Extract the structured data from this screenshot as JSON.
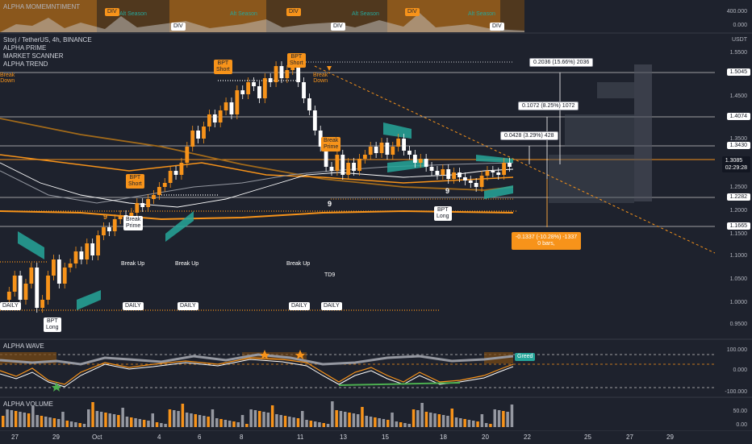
{
  "indicator_top": {
    "title": "ALPHA MOMEMNTIMENT",
    "levels": [
      "400.000",
      "0.000"
    ],
    "signals": [
      "DIV",
      "DIV",
      "DIV",
      "DIV",
      "DIV",
      "DIV"
    ],
    "seasons": [
      "Alt Season",
      "Alt Season",
      "Alt Season",
      "Alt Season"
    ]
  },
  "main": {
    "symbol": "Storj / TetherUS, 4h, BINANCE",
    "indicators": [
      "ALPHA PRIME",
      "MARKET SCANNER",
      "ALPHA TREND"
    ],
    "currency": "USDT",
    "price_ticks": [
      "1.5500",
      "1.4500",
      "1.3500",
      "1.2500",
      "1.2000",
      "1.1500",
      "1.1000",
      "1.0500",
      "1.0000",
      "0.9500"
    ],
    "boxed_levels": [
      "1.5045",
      "1.4074",
      "1.3430",
      "1.2282",
      "1.1665"
    ],
    "last_price": "1.3085",
    "countdown": "02:29:28",
    "measures": [
      "0.2036 (15.66%) 2036",
      "0.1072 (8.25%) 1072",
      "0.0428 (3.29%) 428"
    ],
    "drawdown": {
      "line1": "-0.1337 (-10.28%) -1337",
      "line2": "0 bars,"
    },
    "bpt_short": "BPT\nShort",
    "bpt_long": "BPT\nLong",
    "break_prime": "Break\nPrime",
    "break_down": "Break\nDown",
    "break_up": "Break Up",
    "daily": "DAILY",
    "td9": "TD9",
    "nine": "9"
  },
  "wave": {
    "title": "ALPHA WAVE",
    "levels": [
      "100.000",
      "0.000",
      "-100.000"
    ],
    "badge": "Greed"
  },
  "volume": {
    "title": "ALPHA VOLUME",
    "levels": [
      "50.00",
      "0.00"
    ]
  },
  "xaxis": [
    "27",
    "29",
    "Oct",
    "4",
    "6",
    "8",
    "11",
    "13",
    "15",
    "18",
    "20",
    "22",
    "25",
    "27",
    "29"
  ],
  "colors": {
    "bg": "#1e222d",
    "orange": "#f7931a",
    "teal": "#26a69a",
    "up": "#f7931a",
    "down": "#ffffff"
  }
}
